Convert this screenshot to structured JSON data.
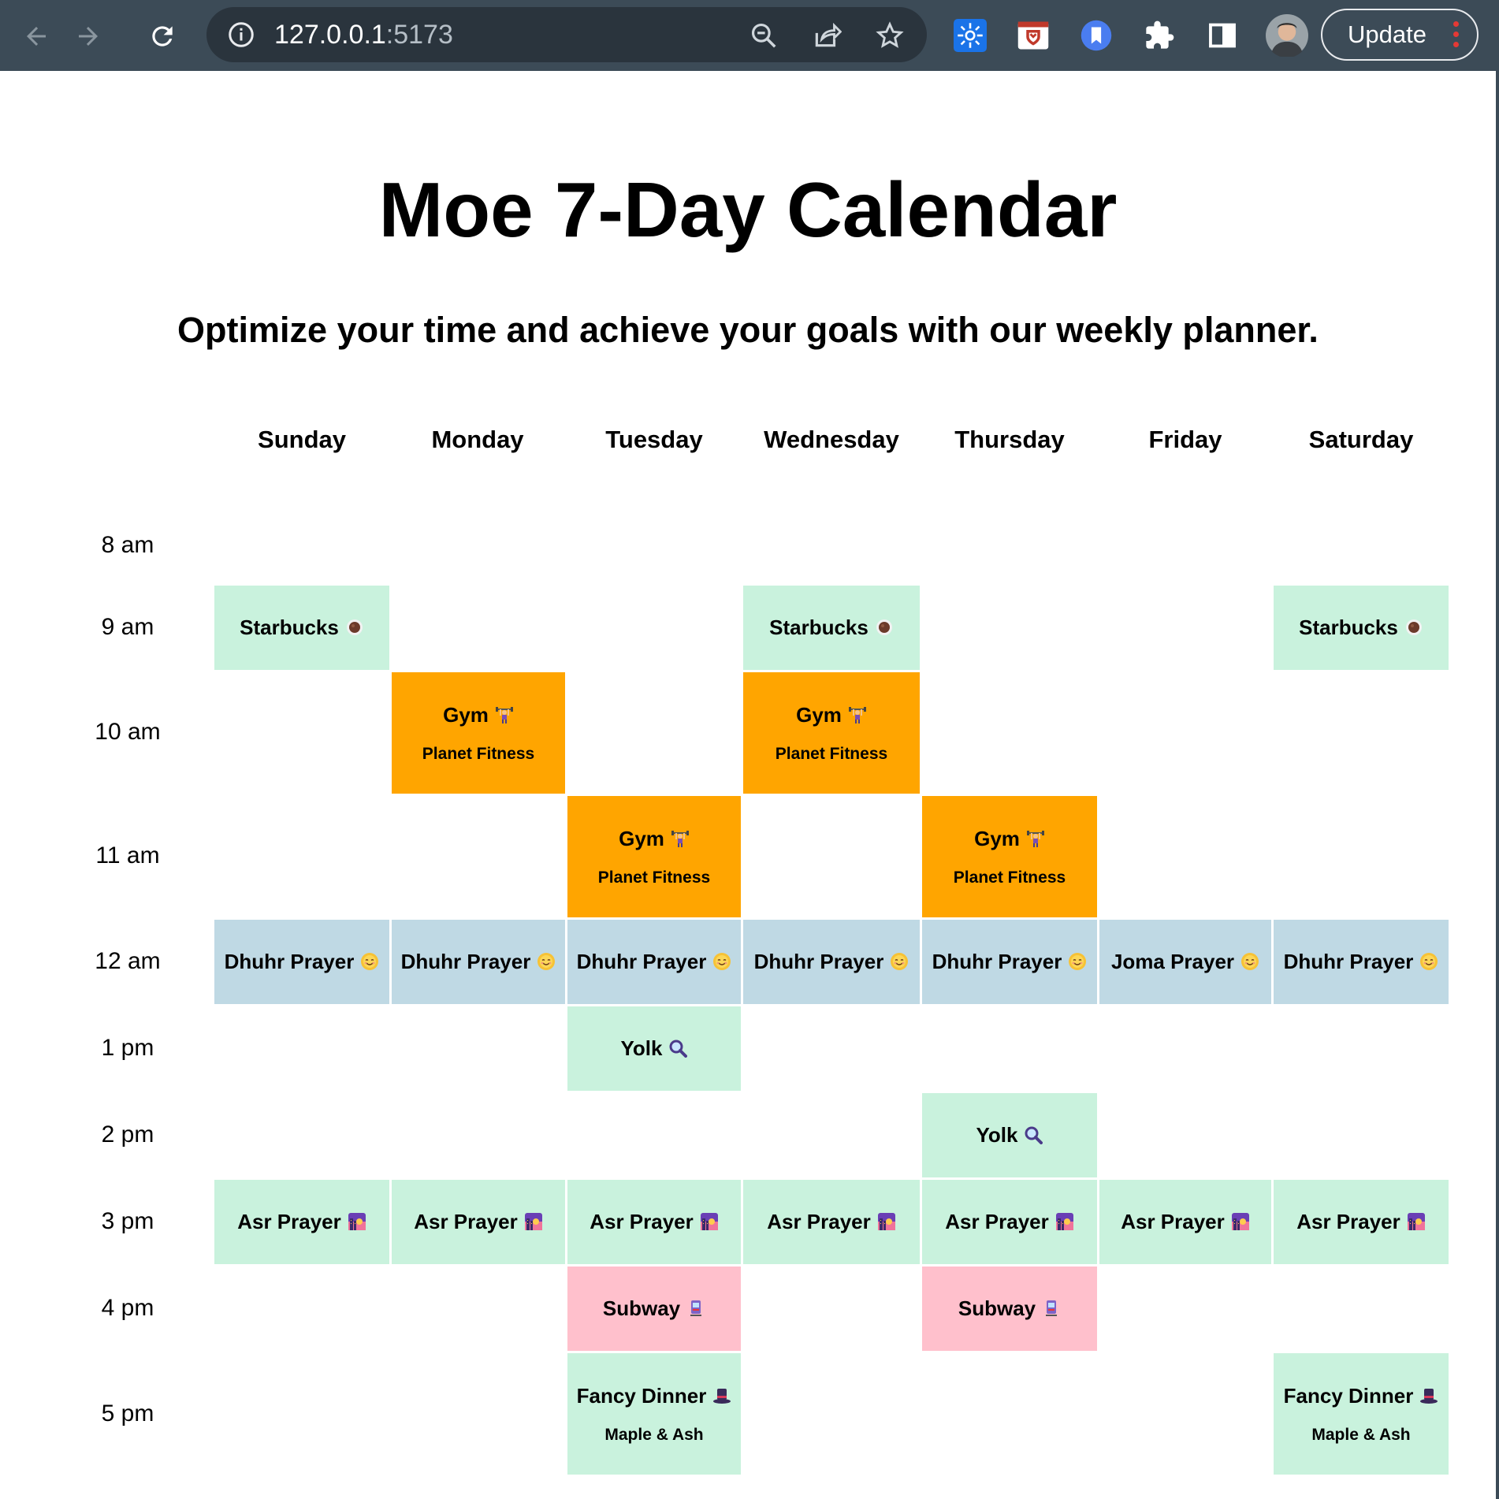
{
  "browser": {
    "url_host": "127.0.0.1",
    "url_port": ":5173",
    "update_label": "Update"
  },
  "page": {
    "title": "Moe 7-Day Calendar",
    "subtitle": "Optimize your time and achieve your goals with our weekly planner."
  },
  "days": [
    "Sunday",
    "Monday",
    "Tuesday",
    "Wednesday",
    "Thursday",
    "Friday",
    "Saturday"
  ],
  "times": [
    "8 am",
    "9 am",
    "10 am",
    "11 am",
    "12 am",
    "1 pm",
    "2 pm",
    "3 pm",
    "4 pm",
    "5 pm"
  ],
  "events": {
    "starbucks": "Starbucks",
    "gym": "Gym",
    "planet_fitness": "Planet Fitness",
    "dhuhr": "Dhuhr Prayer",
    "joma": "Joma Prayer",
    "yolk": "Yolk",
    "asr": "Asr Prayer",
    "subway": "Subway",
    "fancy_dinner": "Fancy Dinner",
    "maple_ash": "Maple & Ash"
  },
  "colors": {
    "green": "#c9f2dd",
    "orange": "#ffa500",
    "blue": "#bfd9e4",
    "pink": "#ffc0cc",
    "chrome": "#3c4b57"
  },
  "icons": {
    "starbucks": "coffee-icon",
    "gym": "weightlifter-icon",
    "prayer": "smiling-sun-icon",
    "yolk": "magnifier-icon",
    "asr": "sunset-icon",
    "subway": "tram-icon",
    "fancy_dinner": "top-hat-icon"
  }
}
